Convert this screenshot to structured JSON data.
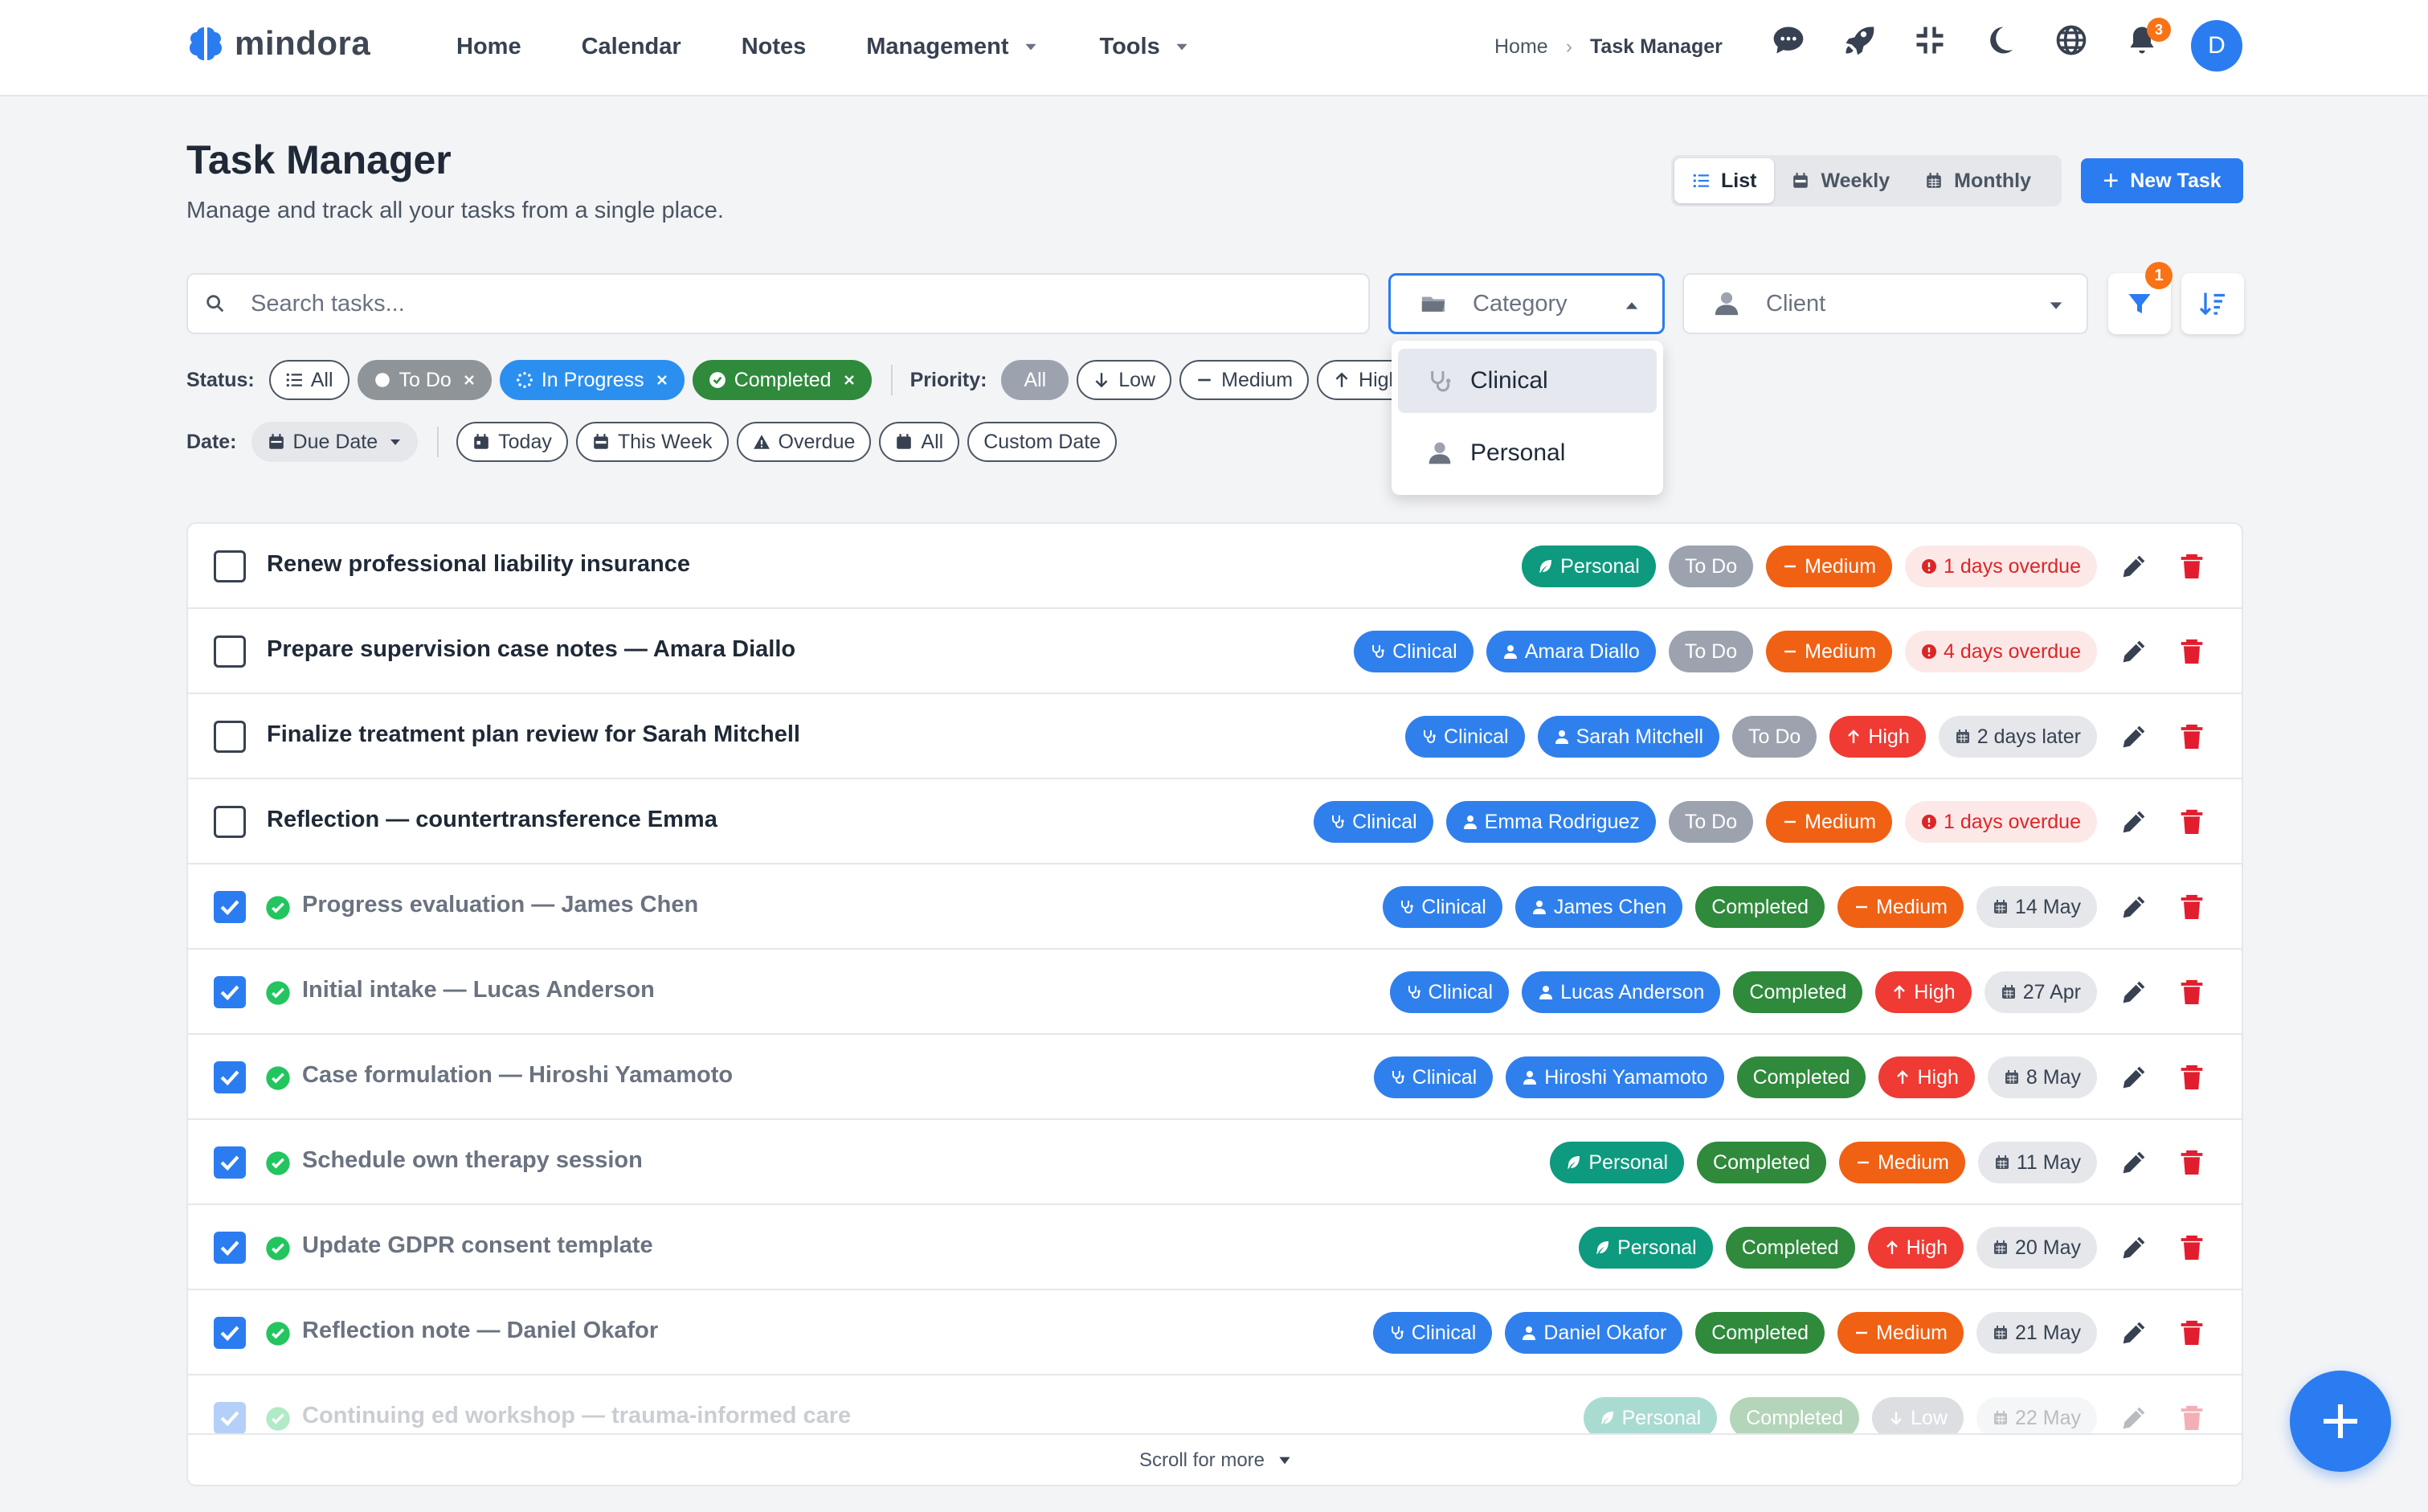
{
  "brand": {
    "name": "mindora"
  },
  "nav": {
    "home": "Home",
    "calendar": "Calendar",
    "notes": "Notes",
    "management": "Management",
    "tools": "Tools"
  },
  "breadcrumb": {
    "home": "Home",
    "current": "Task Manager"
  },
  "notifications": {
    "count": "3"
  },
  "user": {
    "initial": "D"
  },
  "header": {
    "title": "Task Manager",
    "subtitle": "Manage and track all your tasks from a single place."
  },
  "views": {
    "list": "List",
    "weekly": "Weekly",
    "monthly": "Monthly",
    "active": "List"
  },
  "new_task_label": "New Task",
  "search": {
    "placeholder": "Search tasks..."
  },
  "category_select": {
    "placeholder": "Category",
    "options": [
      "Clinical",
      "Personal"
    ],
    "highlighted": "Clinical"
  },
  "client_select": {
    "placeholder": "Client"
  },
  "filter_badge": "1",
  "status_filter": {
    "label": "Status:",
    "all": "All",
    "todo": "To Do",
    "in_progress": "In Progress",
    "completed": "Completed"
  },
  "priority_filter": {
    "label": "Priority:",
    "all": "All",
    "low": "Low",
    "medium": "Medium",
    "high": "High"
  },
  "date_filter": {
    "label": "Date:",
    "due_date": "Due Date",
    "today": "Today",
    "this_week": "This Week",
    "overdue": "Overdue",
    "all": "All",
    "custom": "Custom Date"
  },
  "tasks": [
    {
      "title": "Renew professional liability insurance",
      "done": false,
      "category": "Personal",
      "client": "",
      "status": "To Do",
      "priority": "Medium",
      "due": "1 days overdue",
      "due_type": "overdue"
    },
    {
      "title": "Prepare supervision case notes — Amara Diallo",
      "done": false,
      "category": "Clinical",
      "client": "Amara Diallo",
      "status": "To Do",
      "priority": "Medium",
      "due": "4 days overdue",
      "due_type": "overdue"
    },
    {
      "title": "Finalize treatment plan review for Sarah Mitchell",
      "done": false,
      "category": "Clinical",
      "client": "Sarah Mitchell",
      "status": "To Do",
      "priority": "High",
      "due": "2 days later",
      "due_type": "date"
    },
    {
      "title": "Reflection — countertransference Emma",
      "done": false,
      "category": "Clinical",
      "client": "Emma Rodriguez",
      "status": "To Do",
      "priority": "Medium",
      "due": "1 days overdue",
      "due_type": "overdue"
    },
    {
      "title": "Progress evaluation — James Chen",
      "done": true,
      "category": "Clinical",
      "client": "James Chen",
      "status": "Completed",
      "priority": "Medium",
      "due": "14 May",
      "due_type": "date"
    },
    {
      "title": "Initial intake — Lucas Anderson",
      "done": true,
      "category": "Clinical",
      "client": "Lucas Anderson",
      "status": "Completed",
      "priority": "High",
      "due": "27 Apr",
      "due_type": "date"
    },
    {
      "title": "Case formulation — Hiroshi Yamamoto",
      "done": true,
      "category": "Clinical",
      "client": "Hiroshi Yamamoto",
      "status": "Completed",
      "priority": "High",
      "due": "8 May",
      "due_type": "date"
    },
    {
      "title": "Schedule own therapy session",
      "done": true,
      "category": "Personal",
      "client": "",
      "status": "Completed",
      "priority": "Medium",
      "due": "11 May",
      "due_type": "date"
    },
    {
      "title": "Update GDPR consent template",
      "done": true,
      "category": "Personal",
      "client": "",
      "status": "Completed",
      "priority": "High",
      "due": "20 May",
      "due_type": "date"
    },
    {
      "title": "Reflection note — Daniel Okafor",
      "done": true,
      "category": "Clinical",
      "client": "Daniel Okafor",
      "status": "Completed",
      "priority": "Medium",
      "due": "21 May",
      "due_type": "date"
    },
    {
      "title": "Continuing ed workshop — trauma-informed care",
      "done": true,
      "category": "Personal",
      "client": "",
      "status": "Completed",
      "priority": "Low",
      "due": "22 May",
      "due_type": "date"
    }
  ],
  "scroll_hint": "Scroll for more",
  "colors": {
    "accent": "#2b7cf0",
    "completed": "#2f8a3c",
    "medium": "#f06114",
    "high": "#ef3b33",
    "personal": "#0e9a7f"
  }
}
